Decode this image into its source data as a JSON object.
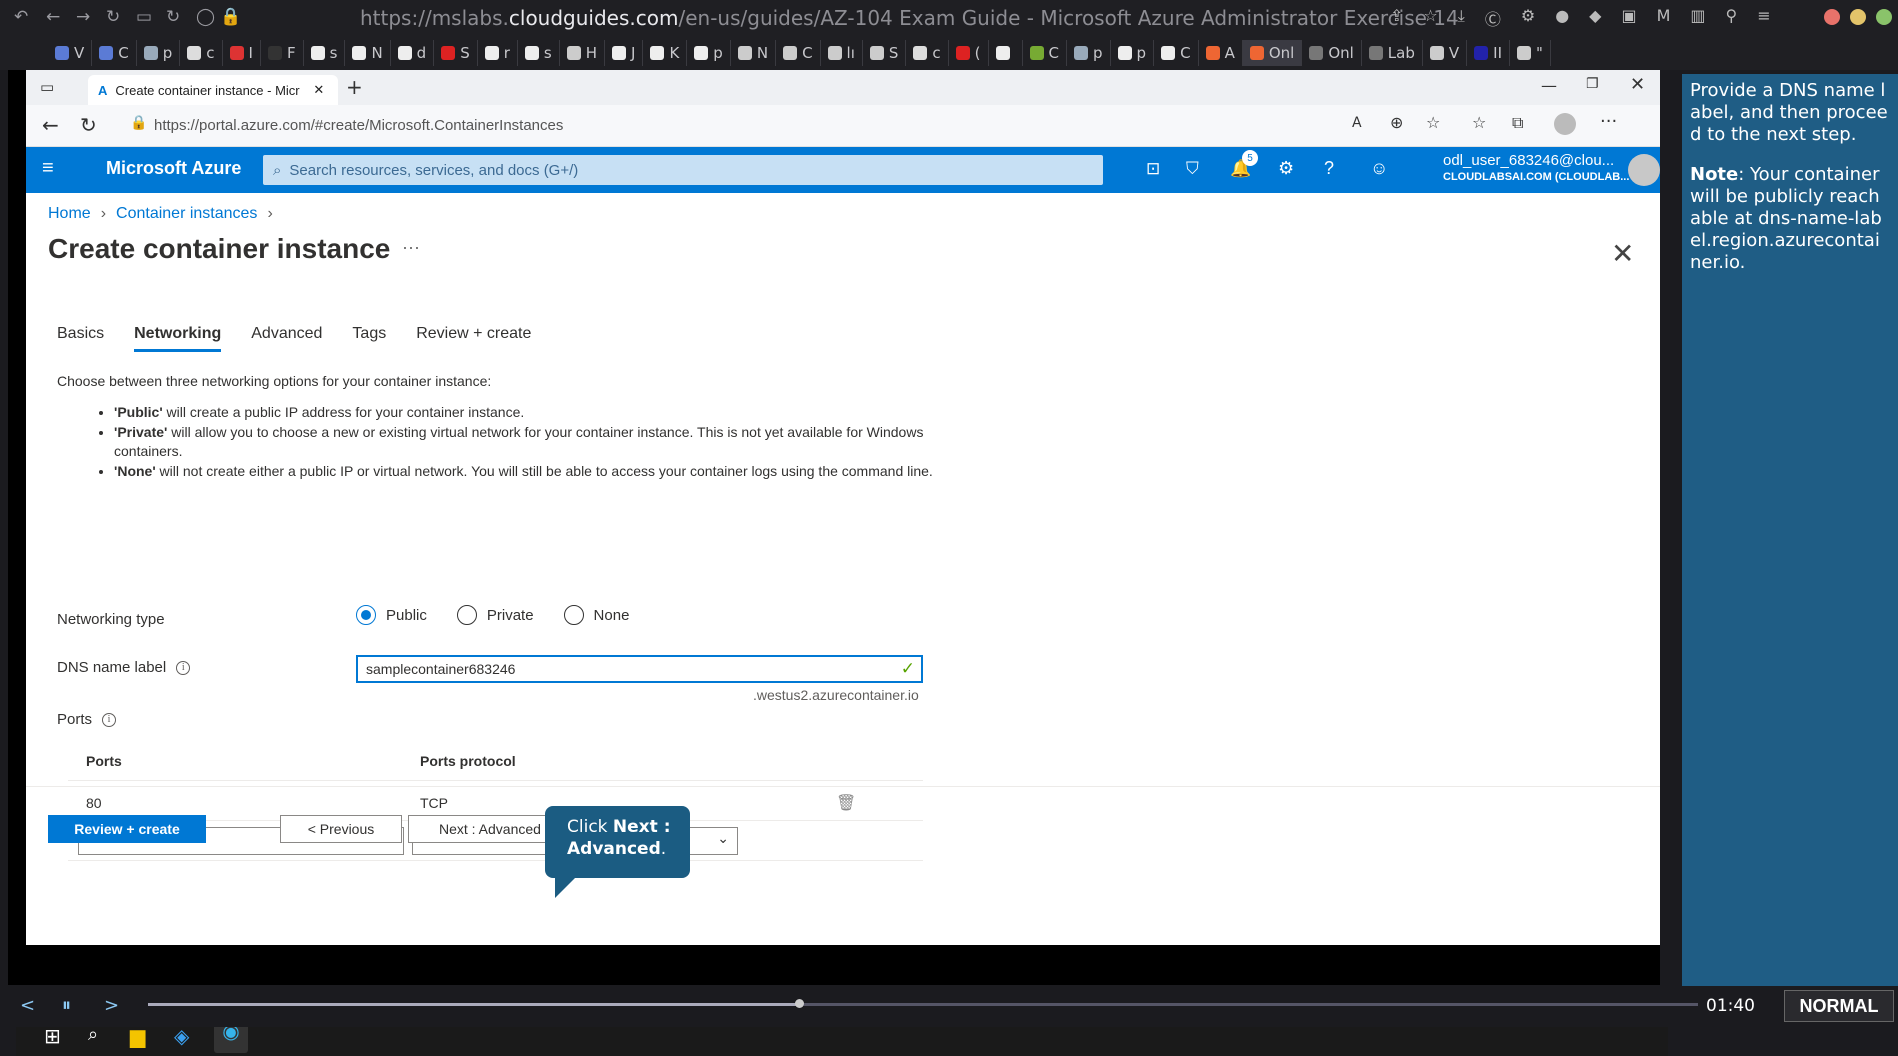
{
  "host_browser": {
    "url_prefix": "https://mslabs.",
    "url_domain": "cloudguides.com",
    "url_suffix": "/en-us/guides/AZ-104 Exam Guide - Microsoft Azure Administrator Exercise 14",
    "tabs": [
      {
        "label": "V",
        "color": "#5b7bd5"
      },
      {
        "label": "C",
        "color": "#5b7bd5"
      },
      {
        "label": "p",
        "color": "#9ab"
      },
      {
        "label": "c",
        "color": "#ddd"
      },
      {
        "label": "I",
        "color": "#d33"
      },
      {
        "label": "F",
        "color": "#333"
      },
      {
        "label": "s",
        "color": "#eee"
      },
      {
        "label": "N",
        "color": "#eee"
      },
      {
        "label": "d",
        "color": "#eee"
      },
      {
        "label": "S",
        "color": "#d22"
      },
      {
        "label": "r",
        "color": "#eee"
      },
      {
        "label": "s",
        "color": "#eee"
      },
      {
        "label": "H",
        "color": "#ccc"
      },
      {
        "label": "J",
        "color": "#eee"
      },
      {
        "label": "K",
        "color": "#eee"
      },
      {
        "label": "p",
        "color": "#eee"
      },
      {
        "label": "N",
        "color": "#ccc"
      },
      {
        "label": "C",
        "color": "#ccc"
      },
      {
        "label": "lı",
        "color": "#ccc"
      },
      {
        "label": "S",
        "color": "#ccc"
      },
      {
        "label": "c",
        "color": "#ddd"
      },
      {
        "label": "(",
        "color": "#d22"
      },
      {
        "label": "",
        "color": "#eee"
      },
      {
        "label": "C",
        "color": "#7a3"
      },
      {
        "label": "p",
        "color": "#9ab"
      },
      {
        "label": "p",
        "color": "#eee"
      },
      {
        "label": "C",
        "color": "#eee"
      },
      {
        "label": "A",
        "color": "#e63"
      },
      {
        "label": "Onl",
        "color": "#e63"
      },
      {
        "label": "Onl",
        "color": "#777"
      },
      {
        "label": "Lab",
        "color": "#777"
      },
      {
        "label": "V",
        "color": "#ccc"
      },
      {
        "label": "II",
        "color": "#22a"
      },
      {
        "label": "\"",
        "color": "#ccc"
      }
    ]
  },
  "edge": {
    "tab_title": "Create container instance - Micr",
    "address": "https://portal.azure.com/#create/Microsoft.ContainerInstances"
  },
  "azure": {
    "brand": "Microsoft Azure",
    "search_placeholder": "Search resources, services, and docs (G+/)",
    "notification_count": "5",
    "user_name": "odl_user_683246@clou...",
    "user_directory": "CLOUDLABSAI.COM (CLOUDLAB..."
  },
  "page": {
    "breadcrumb": [
      "Home",
      "Container instances"
    ],
    "title": "Create container instance",
    "more": "···",
    "tabs": [
      {
        "label": "Basics",
        "active": false
      },
      {
        "label": "Networking",
        "active": true
      },
      {
        "label": "Advanced",
        "active": false
      },
      {
        "label": "Tags",
        "active": false
      },
      {
        "label": "Review + create",
        "active": false
      }
    ],
    "intro": "Choose between three networking options for your container instance:",
    "bullets": [
      {
        "strong": "'Public'",
        "text": " will create a public IP address for your container instance."
      },
      {
        "strong": "'Private'",
        "text": " will allow you to choose a new or existing virtual network for your container instance. This is not yet available for Windows containers."
      },
      {
        "strong": "'None'",
        "text": " will not create either a public IP or virtual network. You will still be able to access your container logs using the command line."
      }
    ],
    "networking_type_label": "Networking type",
    "networking_options": [
      "Public",
      "Private",
      "None"
    ],
    "networking_selected": "Public",
    "dns_label": "DNS name label",
    "dns_value": "samplecontainer683246",
    "dns_suffix": ".westus2.azurecontainer.io",
    "ports_label": "Ports",
    "ports_header": [
      "Ports",
      "Ports protocol"
    ],
    "ports_rows": [
      {
        "port": "80",
        "protocol": "TCP"
      }
    ],
    "buttons": {
      "review": "Review + create",
      "previous": "< Previous",
      "next": "Next : Advanced >"
    }
  },
  "callout": {
    "line1_prefix": "Click ",
    "line1_bold": "Next :",
    "line2_bold": "Advanced",
    "line2_suffix": "."
  },
  "side_panel": {
    "instruction": "Provide a DNS name label, and then proceed to the next step.",
    "note_label": "Note",
    "note_text": ": Your container will be publicly reachable at dns-name-label.region.azurecontainer.io."
  },
  "player": {
    "time": "01:40",
    "mode": "NORMAL",
    "progress": 0.42
  }
}
